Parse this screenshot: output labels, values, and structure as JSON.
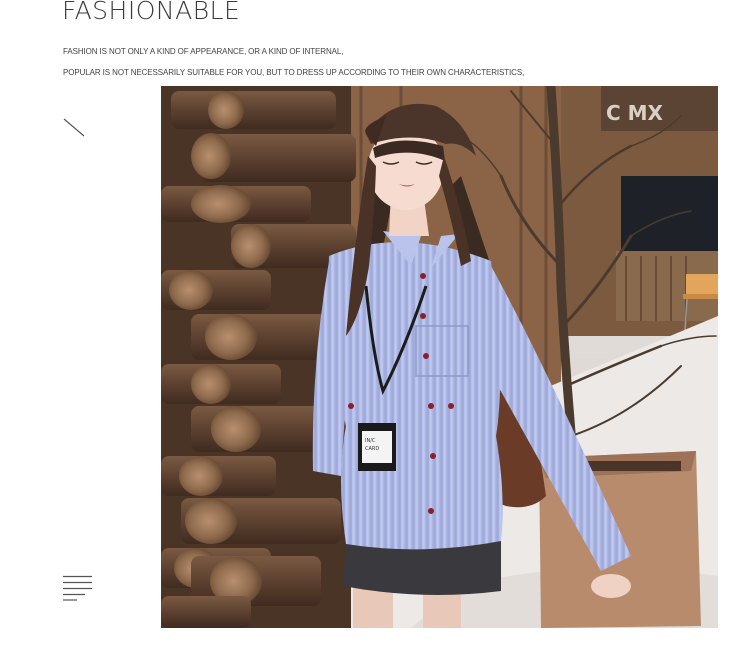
{
  "heading": {
    "title": "FASHIONABLE",
    "line1": "FASHION IS NOT ONLY A KIND OF APPEARANCE, OR A KIND OF INTERNAL,",
    "line2": "POPULAR IS NOT NECESSARILY SUITABLE FOR YOU, BUT TO DRESS UP ACCORDING TO THEIR OWN CHARACTERISTICS,"
  },
  "icons": {
    "slash": "diagonal-line-icon",
    "menu": "menu-lines-icon"
  },
  "photo": {
    "sign_text": "C MX",
    "badge_text": "IN/C\nCARD"
  },
  "colors": {
    "shirt": "#a9b6e6",
    "logs": "#6b4a33",
    "snow": "#e9e6e3",
    "sky": "#dcd6d2",
    "skirt": "#3b3b3f"
  }
}
